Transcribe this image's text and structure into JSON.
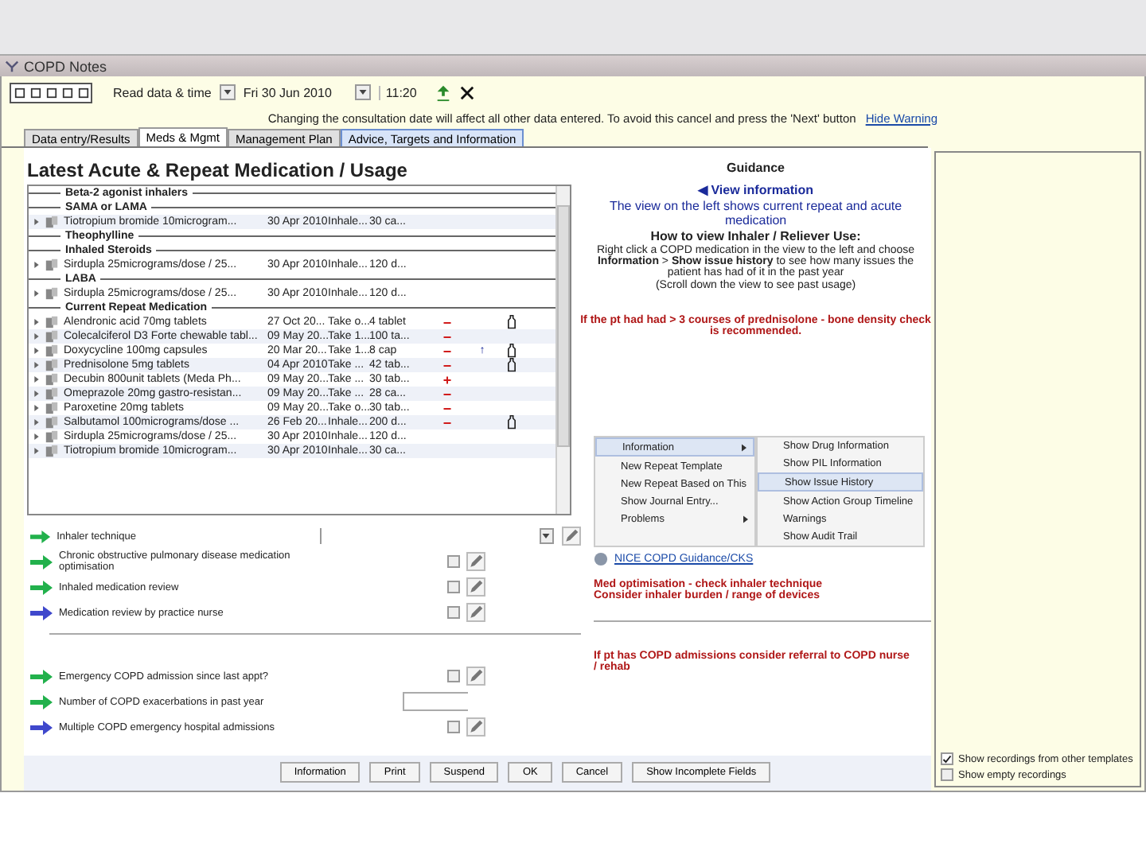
{
  "window": {
    "title": "COPD Notes"
  },
  "toolbar": {
    "date_label": "Read data & time",
    "date": "Fri 30 Jun 2010",
    "time": "11:20"
  },
  "warning": {
    "text": "Changing the consultation date will affect all other data entered. To avoid this cancel and press the 'Next' button",
    "link": "Hide Warning"
  },
  "tabs": [
    {
      "label": "Data entry/Results",
      "selected": false
    },
    {
      "label": "Meds & Mgmt",
      "selected": true
    },
    {
      "label": "Management Plan",
      "selected": false
    },
    {
      "label": "Advice, Targets and Information",
      "selected": false
    }
  ],
  "medication": {
    "title": "Latest Acute & Repeat Medication / Usage",
    "rows": [
      {
        "kind": "header",
        "text": "Beta-2 agonist inhalers"
      },
      {
        "kind": "header",
        "text": "SAMA or LAMA"
      },
      {
        "kind": "med",
        "name": "Tiotropium bromide 10microgram...",
        "date": "30 Apr 2010",
        "dose": "Inhale...",
        "qty": "30 ca..."
      },
      {
        "kind": "header",
        "text": "Theophylline"
      },
      {
        "kind": "header",
        "text": "Inhaled Steroids"
      },
      {
        "kind": "med",
        "name": "Sirdupla 25micrograms/dose / 25...",
        "date": "30 Apr 2010",
        "dose": "Inhale...",
        "qty": "120 d..."
      },
      {
        "kind": "header",
        "text": "LABA"
      },
      {
        "kind": "med",
        "name": "Sirdupla 25micrograms/dose / 25...",
        "date": "30 Apr 2010",
        "dose": "Inhale...",
        "qty": "120 d..."
      },
      {
        "kind": "header",
        "text": "Current Repeat Medication"
      },
      {
        "kind": "med",
        "name": "Alendronic acid 70mg tablets",
        "date": "27 Oct 20...",
        "dose": "Take o...",
        "qty": "4 tablet",
        "change": "−",
        "container": true
      },
      {
        "kind": "med",
        "name": "Colecalciferol D3 Forte chewable tabl...",
        "date": "09 May 20...",
        "dose": "Take 1...",
        "qty": "100 ta...",
        "change": "−"
      },
      {
        "kind": "med",
        "name": "Doxycycline 100mg capsules",
        "date": "20 Mar 20...",
        "dose": "Take 1...",
        "qty": "8 cap",
        "change": "−",
        "trend": "↑",
        "container": true
      },
      {
        "kind": "med",
        "name": "Prednisolone 5mg tablets",
        "date": "04 Apr 2010",
        "dose": "Take ...",
        "qty": "42 tab...",
        "change": "−",
        "container": true
      },
      {
        "kind": "med",
        "name": "Decubin 800unit tablets (Meda Ph...",
        "date": "09 May 20...",
        "dose": "Take ...",
        "qty": "30 tab...",
        "change": "+"
      },
      {
        "kind": "med",
        "name": "Omeprazole 20mg gastro-resistan...",
        "date": "09 May 20...",
        "dose": "Take ...",
        "qty": "28 ca...",
        "change": "−"
      },
      {
        "kind": "med",
        "name": "Paroxetine 20mg tablets",
        "date": "09 May 20...",
        "dose": "Take o...",
        "qty": "30 tab...",
        "change": "−"
      },
      {
        "kind": "med",
        "name": "Salbutamol 100micrograms/dose ...",
        "date": "26 Feb 20...",
        "dose": "Inhale...",
        "qty": "200 d...",
        "change": "−",
        "container": true
      },
      {
        "kind": "med",
        "name": "Sirdupla 25micrograms/dose / 25...",
        "date": "30 Apr 2010",
        "dose": "Inhale...",
        "qty": "120 d..."
      },
      {
        "kind": "med",
        "name": "Tiotropium bromide 10microgram...",
        "date": "30 Apr 2010",
        "dose": "Inhale...",
        "qty": "30 ca..."
      }
    ]
  },
  "form_items": [
    {
      "kind": "dropdown",
      "label": "Inhaler technique",
      "color": "#22b14c"
    },
    {
      "kind": "checkbox",
      "label": "Chronic obstructive pulmonary disease medication optimisation",
      "color": "#22b14c",
      "checked": false
    },
    {
      "kind": "checkbox",
      "label": "Inhaled medication review",
      "color": "#22b14c",
      "checked": false
    },
    {
      "kind": "checkbox",
      "label": "Medication review by practice nurse",
      "color": "#3f48cc",
      "checked": false
    },
    {
      "kind": "divider"
    },
    {
      "kind": "checkbox",
      "label": "Emergency COPD admission since last appt?",
      "color": "#22b14c",
      "checked": false
    },
    {
      "kind": "number",
      "label": "Number of COPD exacerbations in past year",
      "color": "#22b14c"
    },
    {
      "kind": "checkbox",
      "label": "Multiple COPD emergency hospital admissions",
      "color": "#3f48cc",
      "checked": false
    }
  ],
  "guidance": {
    "title": "Guidance",
    "view_link": "◀ View information",
    "intro": "The view on the left shows current repeat and acute medication",
    "heading": "How to view Inhaler / Reliever Use:",
    "instructions": "Right click a COPD medication in the view to the left and choose **Information** > **Show issue history** to see how many issues the patient has had of it in the past year",
    "note": "(Scroll down the view to see past usage)",
    "alert": "If the pt had had > 3 courses of prednisolone - bone density check is recommended."
  },
  "context_menu": {
    "items": [
      {
        "label": "Information",
        "submenu": true,
        "selected": true
      },
      {
        "label": "New Repeat Template",
        "submenu": false,
        "selected": false
      },
      {
        "label": "New Repeat Based on This",
        "submenu": false,
        "selected": false
      },
      {
        "label": "Show Journal Entry...",
        "submenu": false,
        "selected": false
      },
      {
        "label": "Problems",
        "submenu": true,
        "selected": false
      }
    ],
    "submenu": [
      {
        "label": "Show Drug Information",
        "selected": false
      },
      {
        "label": "Show PIL Information",
        "selected": false
      },
      {
        "label": "Show Issue History",
        "selected": true
      },
      {
        "label": "Show Action Group Timeline",
        "selected": false
      },
      {
        "label": "Warnings",
        "selected": false
      },
      {
        "label": "Show Audit Trail",
        "selected": false
      }
    ]
  },
  "guidance_link": "NICE COPD Guidance/CKS",
  "guidance_notes": [
    "Med optimisation - check inhaler technique",
    "Consider inhaler burden / range of devices"
  ],
  "admission_note": "If pt has COPD admissions consider referral to COPD nurse / rehab",
  "buttons": [
    "Information",
    "Print",
    "Suspend",
    "OK",
    "Cancel",
    "Show Incomplete Fields"
  ],
  "options": [
    {
      "label": "Show recordings from other templates",
      "checked": true
    },
    {
      "label": "Show empty recordings",
      "checked": false
    }
  ]
}
